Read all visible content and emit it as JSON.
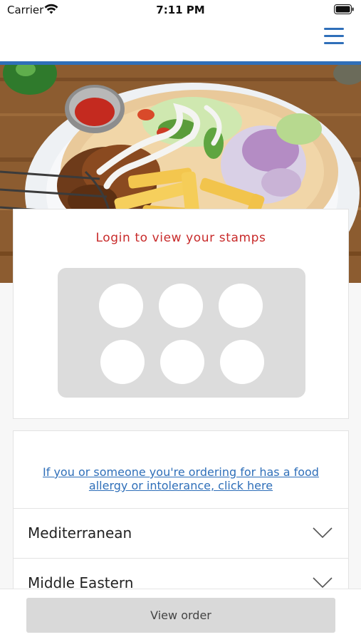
{
  "status_bar": {
    "carrier": "Carrier",
    "time": "7:11 PM"
  },
  "header": {
    "menu_icon": "hamburger-menu-icon",
    "accent_color": "#2f6fb9"
  },
  "hero": {
    "image": "kebab-plate-with-fries-and-salad"
  },
  "stamps": {
    "login_label": "Login to view your stamps",
    "login_color": "#c82a2a",
    "total_stamps": 6,
    "filled_stamps": 0
  },
  "allergy": {
    "line1": "If you or someone you're ordering for has a food",
    "line2": "allergy or intolerance, click here"
  },
  "categories": [
    {
      "label": "Mediterranean",
      "icon": "chevron-down-icon"
    },
    {
      "label": "Middle Eastern",
      "icon": "chevron-down-icon"
    }
  ],
  "footer": {
    "view_order_label": "View order"
  }
}
